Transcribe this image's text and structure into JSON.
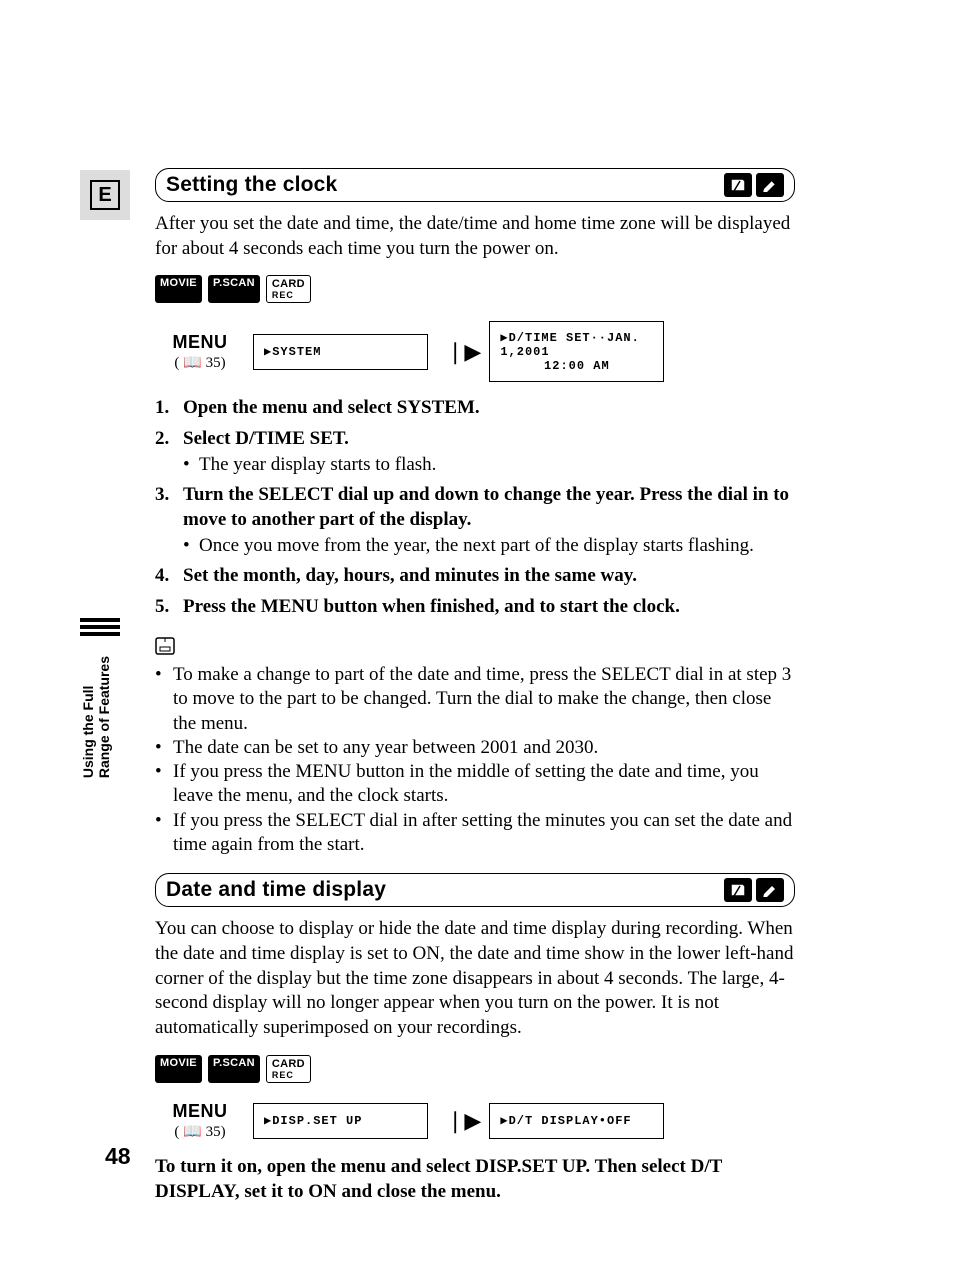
{
  "lang_box": "E",
  "sections": {
    "clock": {
      "title": "Setting the clock",
      "intro": "After you set the date and time, the date/time and home time zone will be displayed for about 4 seconds each time you turn the power on.",
      "modes": [
        "MOVIE",
        "P.SCAN"
      ],
      "card_mode": {
        "top": "CARD",
        "bottom": "REC"
      },
      "menu": {
        "word": "MENU",
        "ref": "( 📖 35)",
        "box1": "▶SYSTEM",
        "box2_l1": "▶D/TIME SET··JAN. 1,2001",
        "box2_l2": "12:00 AM"
      },
      "steps": [
        {
          "main": "Open the menu and select SYSTEM."
        },
        {
          "main": "Select D/TIME SET.",
          "sub": [
            "The year display starts to flash."
          ]
        },
        {
          "main": "Turn the SELECT dial up and down to change the year. Press the dial in to move to another part of the display.",
          "sub": [
            "Once you move from the year, the next part of the display starts flashing."
          ]
        },
        {
          "main": "Set the month, day, hours, and minutes in the same way."
        },
        {
          "main": "Press the MENU button when finished, and to start the clock."
        }
      ],
      "tips": [
        "To make a change to part of the date and time, press the SELECT dial in at step 3 to move to the part to be changed. Turn the dial to make the change, then close the menu.",
        "The date can be set to any year between 2001 and 2030.",
        "If you press the MENU button in the middle of setting the date and time, you leave the menu, and the clock starts.",
        "If you press the SELECT dial in after setting the minutes you can set the date and time again from the start."
      ]
    },
    "display": {
      "title": "Date and time display",
      "intro": "You can choose to display or hide the date and time display during recording. When the date and time display is set to ON, the date and time show in the lower left-hand corner of the display but the time zone disappears in about 4 seconds. The large, 4-second display will no longer appear when you turn on the power. It is not automatically superimposed on your recordings.",
      "modes": [
        "MOVIE",
        "P.SCAN"
      ],
      "card_mode": {
        "top": "CARD",
        "bottom": "REC"
      },
      "menu": {
        "word": "MENU",
        "ref": "( 📖 35)",
        "box1": "▶DISP.SET UP",
        "box2": "▶D/T DISPLAY•OFF"
      },
      "tail": "To turn it on, open the menu and select DISP.SET UP. Then select D/T DISPLAY, set it to ON and close the menu."
    }
  },
  "side_tab": {
    "line1": "Using the Full",
    "line2": "Range of Features"
  },
  "page_number": "48"
}
